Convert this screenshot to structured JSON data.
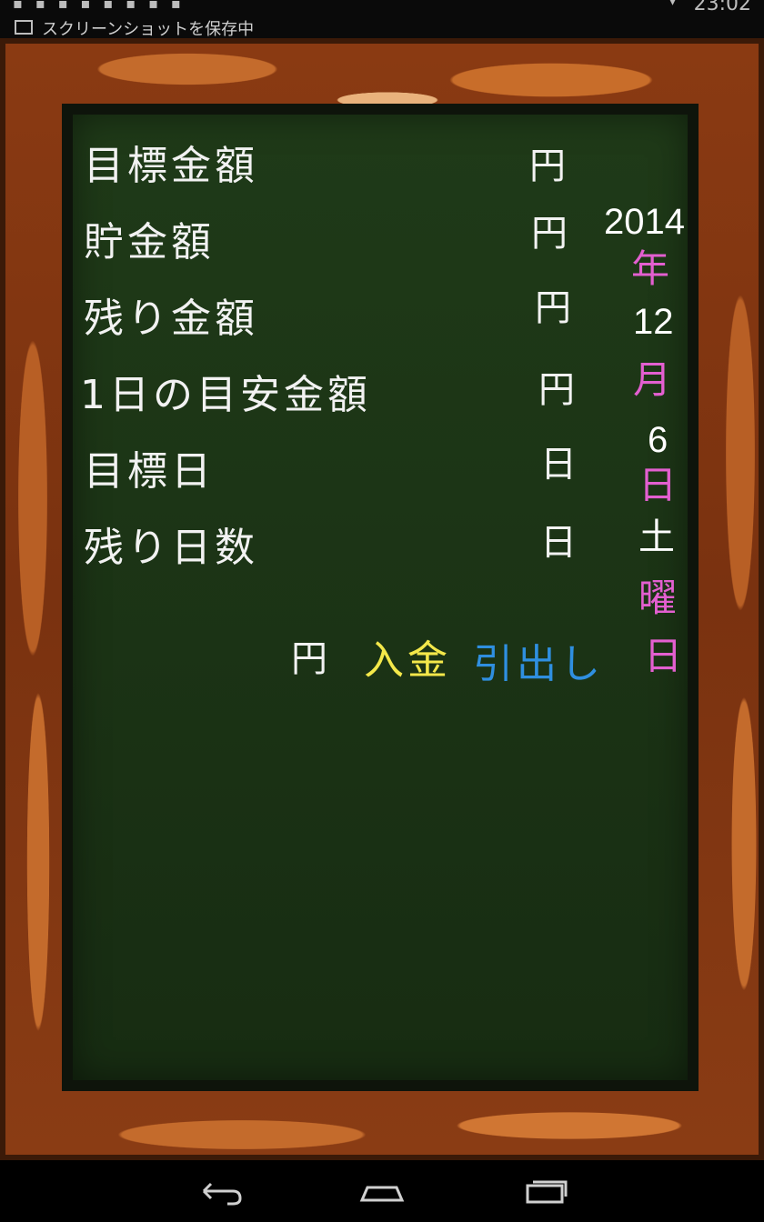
{
  "status_bar": {
    "notification_text": "スクリーンショットを保存中",
    "clock": "23:02"
  },
  "board": {
    "rows": [
      {
        "label": "目標金額",
        "unit": "円"
      },
      {
        "label": "貯金額",
        "unit": "円"
      },
      {
        "label": "残り金額",
        "unit": "円"
      },
      {
        "label": "1日の目安金額",
        "unit": "円"
      },
      {
        "label": "目標日",
        "unit": "日"
      },
      {
        "label": "残り日数",
        "unit": "日"
      }
    ],
    "amount_unit": "円",
    "deposit_label": "入金",
    "withdraw_label": "引出し"
  },
  "date": {
    "year": "2014",
    "year_suffix": "年",
    "month": "12",
    "month_suffix": "月",
    "day": "6",
    "day_suffix": "日",
    "weekday": "土",
    "weekday_suffix_1": "曜",
    "weekday_suffix_2": "日"
  },
  "colors": {
    "board": "#1d3616",
    "wood": "#8a3a12",
    "deposit": "#f4e84a",
    "withdraw": "#2f8fe0",
    "date_accent": "#e35fd0"
  },
  "nav": {
    "back_icon": "back-icon",
    "home_icon": "home-icon",
    "recents_icon": "recents-icon"
  }
}
